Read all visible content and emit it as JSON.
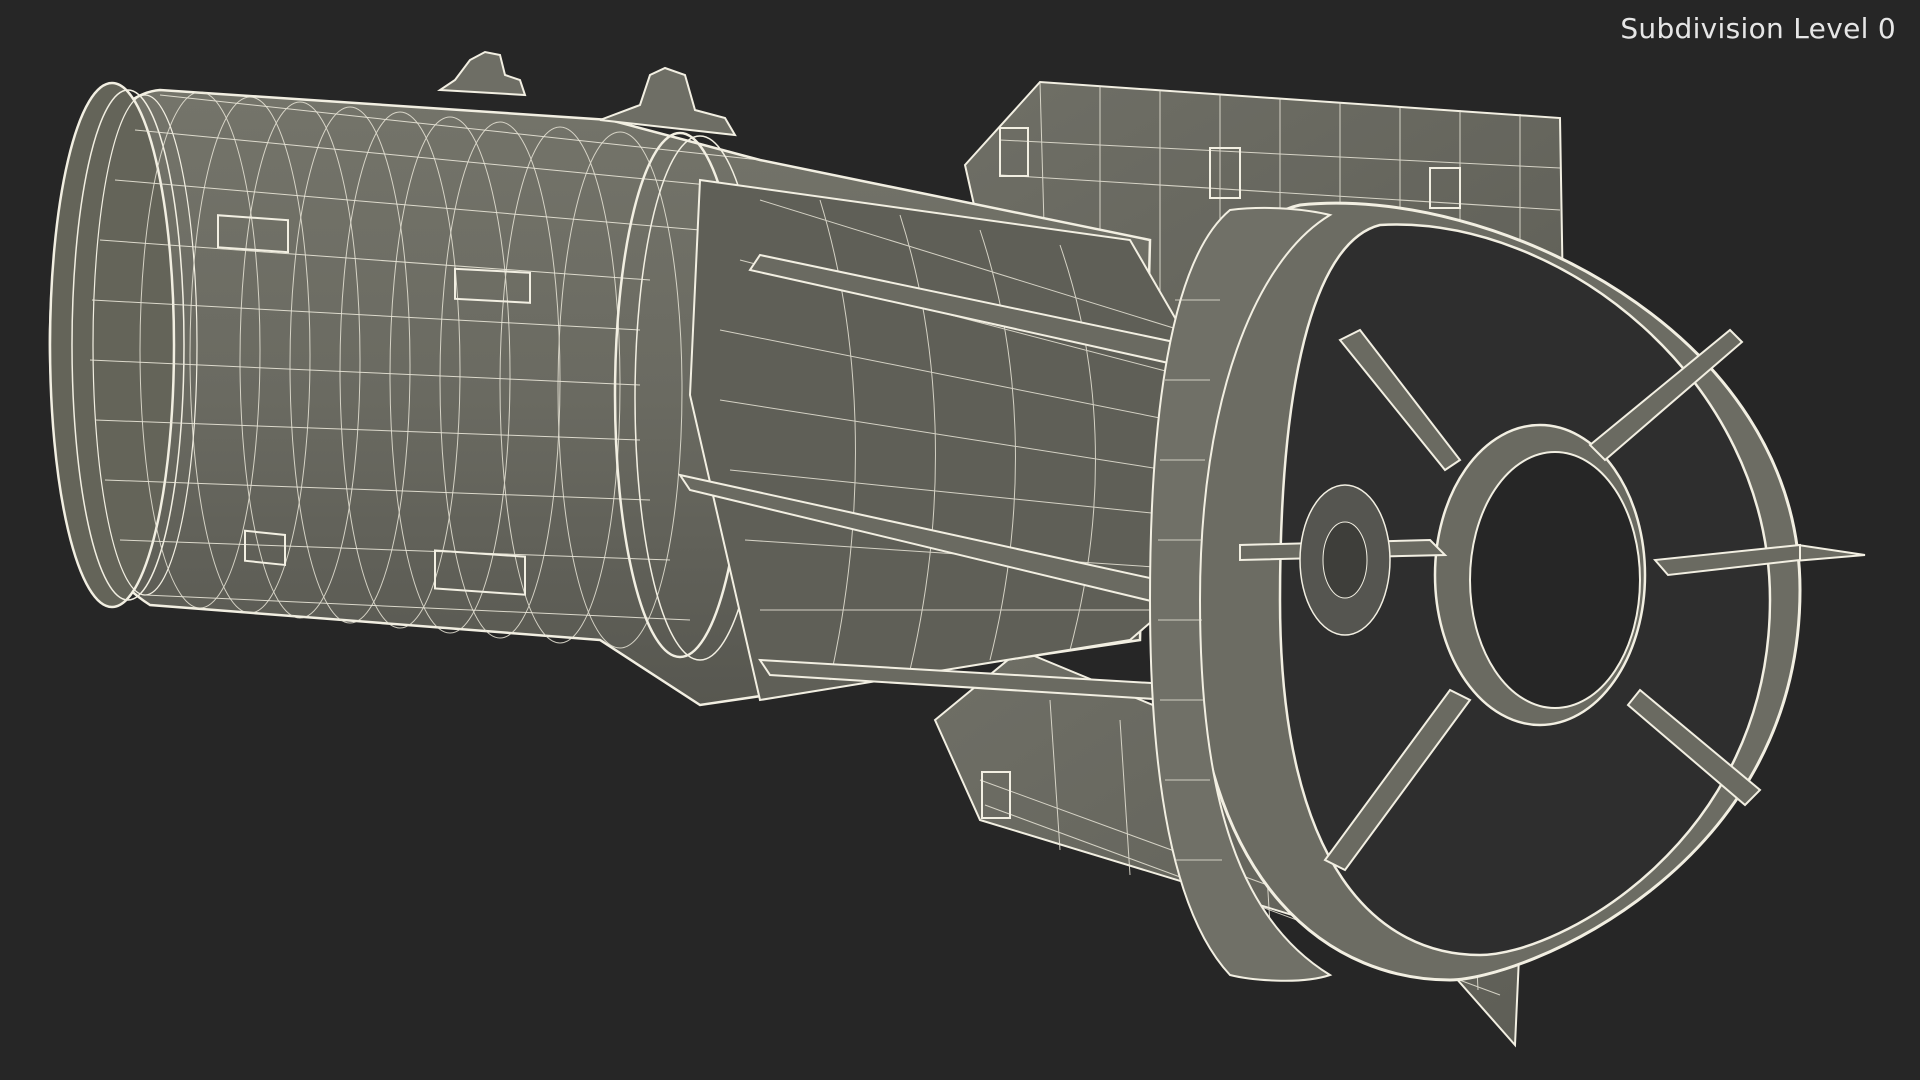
{
  "viewport": {
    "overlay_label": "Subdivision Level 0",
    "background_color": "#262626",
    "model_fill_color": "#6b6b62",
    "model_shade_color": "#5a5a52",
    "wire_color": "#f2efe2",
    "model_type": "wireframe-bomb-with-ring-tail"
  }
}
